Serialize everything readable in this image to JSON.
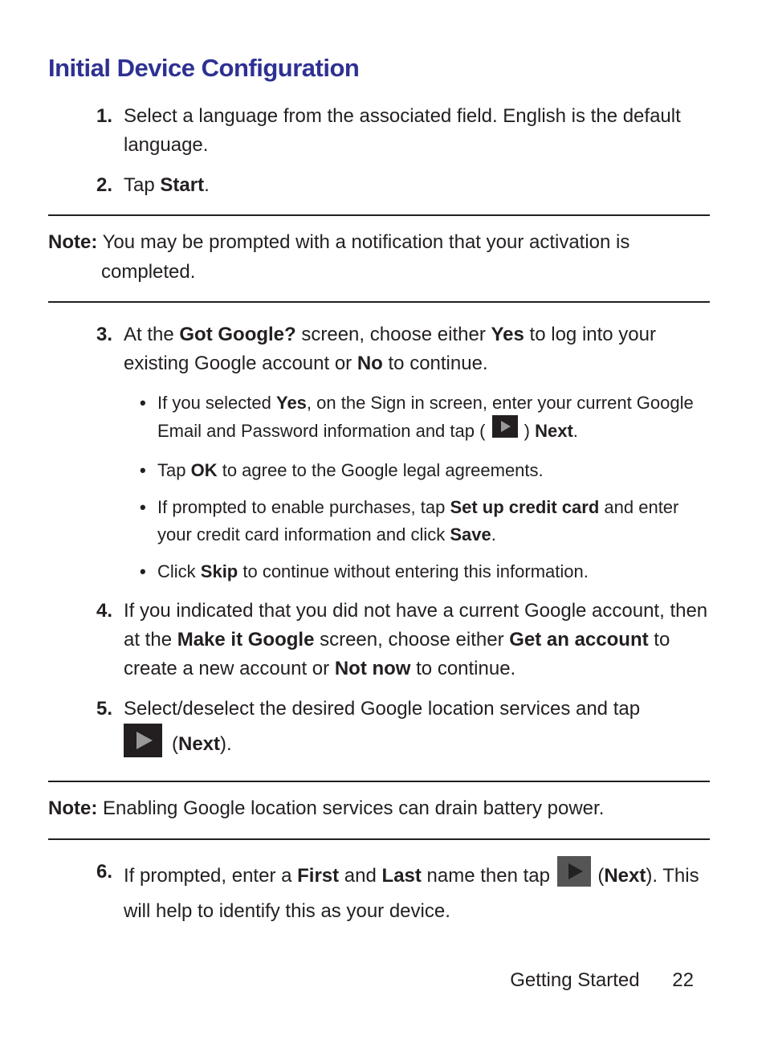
{
  "title": "Initial Device Configuration",
  "steps": {
    "s1": {
      "num": "1.",
      "text": "Select a language from the associated field. English is the default language."
    },
    "s2": {
      "num": "2.",
      "pre": "Tap ",
      "b1": "Start",
      "post": "."
    },
    "s3": {
      "num": "3.",
      "pre": "At the ",
      "b1": "Got Google?",
      "mid1": " screen, choose either ",
      "b2": "Yes",
      "mid2": " to log into your existing Google account or ",
      "b3": "No",
      "post": " to continue.",
      "sub1": {
        "pre": "If you selected ",
        "b1": "Yes",
        "mid": ", on the Sign in screen, enter your current Google Email and Password information and tap ( ",
        "post": " ) ",
        "b2": "Next",
        "end": "."
      },
      "sub2": {
        "pre": "Tap ",
        "b1": "OK",
        "post": " to agree to the Google legal agreements."
      },
      "sub3": {
        "pre": "If prompted to enable purchases, tap ",
        "b1": "Set up credit card",
        "mid": " and enter your credit card information and click ",
        "b2": "Save",
        "post": "."
      },
      "sub4": {
        "pre": "Click ",
        "b1": "Skip",
        "post": " to continue without entering this information."
      }
    },
    "s4": {
      "num": "4.",
      "pre": "If you indicated that you did not have a current Google account, then at the ",
      "b1": "Make it Google",
      "mid1": " screen, choose either ",
      "b2": "Get an account",
      "mid2": " to create a new account or ",
      "b3": "Not now",
      "post": " to continue."
    },
    "s5": {
      "num": "5.",
      "pre": "Select/deselect the desired Google location services and tap",
      "b1": "Next",
      "post": ")."
    },
    "s6": {
      "num": "6.",
      "pre": "If prompted, enter a ",
      "b1": "First",
      "mid1": " and ",
      "b2": "Last",
      "mid2": " name then tap ",
      "post1": " (",
      "b3": "Next",
      "post2": "). This will help to identify this as your device."
    }
  },
  "notes": {
    "n1": {
      "label": "Note:",
      "text": " You may be prompted with a notification that your activation is",
      "cont": "completed."
    },
    "n2": {
      "label": "Note:",
      "text": " Enabling Google location services can drain battery power."
    }
  },
  "footer": {
    "section": "Getting Started",
    "page": "22"
  }
}
